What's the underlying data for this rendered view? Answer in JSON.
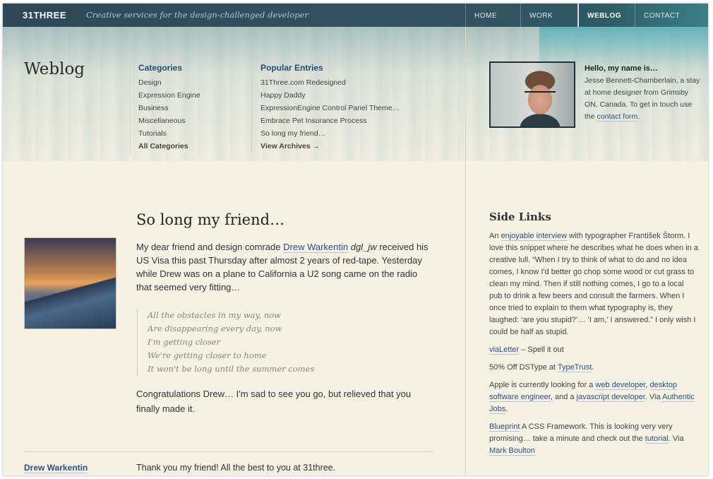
{
  "site": {
    "logo": "31THREE",
    "tagline": "Creative services for the design-challenged developer",
    "nav": [
      "HOME",
      "WORK",
      "WEBLOG",
      "CONTACT"
    ],
    "nav_active": "WEBLOG"
  },
  "page_title": "Weblog",
  "categories": {
    "heading": "Categories",
    "items": [
      "Design",
      "Expression Engine",
      "Business",
      "Miscellaneous",
      "Tutorials"
    ],
    "all_label": "All Categories"
  },
  "popular": {
    "heading": "Popular Entries",
    "items": [
      "31Three.com Redesigned",
      "Happy Daddy",
      "ExpressionEngine Control Panel Theme…",
      "Embrace Pet Insurance Process",
      "So long my friend…"
    ],
    "archives_label": "View Archives →"
  },
  "profile": {
    "heading": "Hello, my name is…",
    "text": "Jesse Bennett-Chamberlain, a stay at home designer from Grimsby ON, Canada. To get in touch use the",
    "link": "contact form",
    "end": "."
  },
  "post": {
    "title": "So long my friend…",
    "p1_a": "My dear friend and design comrade ",
    "p1_link": "Drew Warkentin",
    "p1_em": " dgl_jw",
    "p1_b": " received his US Visa this past Thursday after almost 2 years of red-tape. Yesterday while Drew was on a plane to California a U2 song came on the radio that seemed very fitting…",
    "quote": [
      "All the obstacles in my way, now",
      "Are disappearing every day, now",
      "I'm getting closer",
      "We're getting closer to home",
      "It won't be long until the summer comes"
    ],
    "p2": "Congratulations Drew… I'm sad to see you go, but relieved that you finally made it."
  },
  "comment": {
    "author": "Drew Warkentin",
    "text": "Thank you my friend! All the best to you at 31three."
  },
  "side_links": {
    "heading": "Side Links",
    "p1_a": "An ",
    "p1_link": "enjoyable interview",
    "p1_b": " with typographer František Štorm. I love this snippet where he describes what he does when in a creative lull. “When I try to think of what to do and no idea comes, I know I'd better go chop some wood or cut grass to clean my mind. Then if still nothing comes, I go to a local pub to drink a few beers and consult the farmers. When I once tried to explain to them what typography is, they laughed: ‘are you stupid?’… ‘I am,’ I answered.” I only wish I could be half as stupid.",
    "p2_link": "viaLetter",
    "p2_b": " – Spell it out",
    "p3_a": "50% Off DSType at ",
    "p3_link": "TypeTrust",
    "p3_end": ".",
    "p4_a": "Apple is currently looking for a ",
    "p4_l1": "web developer",
    "p4_s1": ", ",
    "p4_l2": "desktop software engineer",
    "p4_s2": ", and a ",
    "p4_l3": "javascript developer",
    "p4_s3": ". Via ",
    "p4_l4": "Authentic Jobs",
    "p4_end": ".",
    "p5_link": "Blueprint",
    "p5_b": " A CSS Framework. This is looking very very promising… take a minute and check out the ",
    "p5_l2": "tutorial",
    "p5_c": ". Via ",
    "p5_l3": "Mark Boulton"
  }
}
